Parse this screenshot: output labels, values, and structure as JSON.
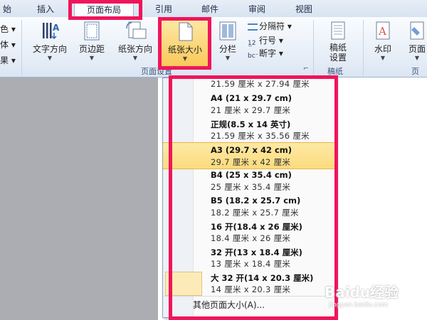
{
  "tabs": [
    {
      "label": "始"
    },
    {
      "label": "插入"
    },
    {
      "label": "页面布局"
    },
    {
      "label": "引用"
    },
    {
      "label": "邮件"
    },
    {
      "label": "审阅"
    },
    {
      "label": "视图"
    }
  ],
  "ribbon": {
    "left_fragments": [
      "色",
      "体",
      "果"
    ],
    "text_direction": "文字方向",
    "margins": "页边距",
    "orientation": "纸张方向",
    "size": "纸张大小",
    "columns": "分栏",
    "breaks": "分隔符",
    "line_numbers": "行号",
    "hyphenation": "断字",
    "page_setup_group": "页面设置",
    "manuscript": [
      "稿纸",
      "设置"
    ],
    "manuscript_group": "稿纸",
    "watermark": "水印",
    "page_color": "页面",
    "page_bg_group": "页"
  },
  "dropdown": {
    "partial_item": "21.59 厘米 x 27.94 厘米",
    "items": [
      {
        "name": "A4 (21 x 29.7 cm)",
        "dims": "21 厘米 x 29.7 厘米"
      },
      {
        "name": "正规(8.5 x 14 英寸)",
        "dims": "21.59 厘米 x 35.56 厘米"
      },
      {
        "name": "A3 (29.7 x 42 cm)",
        "dims": "29.7 厘米 x 42 厘米"
      },
      {
        "name": "B4 (25 x 35.4 cm)",
        "dims": "25 厘米 x 35.4 厘米"
      },
      {
        "name": "B5 (18.2 x 25.7 cm)",
        "dims": "18.2 厘米 x 25.7 厘米"
      },
      {
        "name": "16 开(18.4 x 26 厘米)",
        "dims": "18.4 厘米 x 26 厘米"
      },
      {
        "name": "32 开(13 x 18.4 厘米)",
        "dims": "13 厘米 x 18.4 厘米"
      },
      {
        "name": "大 32 开(14 x 20.3 厘米)",
        "dims": "14 厘米 x 20.3 厘米"
      }
    ],
    "more_sizes": "其他页面大小(A)..."
  },
  "watermark_text": "Baidu经验",
  "watermark_sub": "jingyan.baidu.com",
  "colors": {
    "highlight": "#f0155b",
    "selected": "#fcdb7d",
    "ribbon": "#e3ebf6"
  }
}
